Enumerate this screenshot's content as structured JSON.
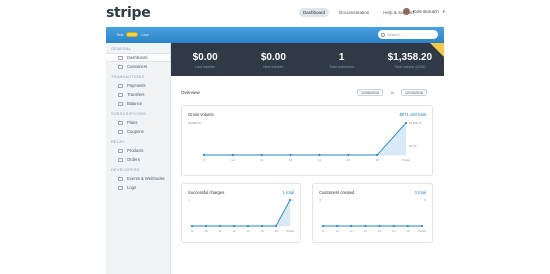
{
  "app": {
    "logo": "stripe"
  },
  "topnav": {
    "items": [
      "Dashboard",
      "Documentation",
      "Help & Support"
    ],
    "user_name": "Kole Borutch"
  },
  "mode": {
    "test_label": "Test",
    "live_label": "Live"
  },
  "search": {
    "placeholder": "Search..."
  },
  "sidebar": {
    "sections": [
      {
        "title": "GENERAL",
        "items": [
          "Dashboard",
          "Customers"
        ]
      },
      {
        "title": "TRANSACTIONS",
        "items": [
          "Payments",
          "Transfers",
          "Balance"
        ]
      },
      {
        "title": "SUBSCRIPTIONS",
        "items": [
          "Plans",
          "Coupons"
        ]
      },
      {
        "title": "RELAY",
        "items": [
          "Products",
          "Orders"
        ]
      },
      {
        "title": "DEVELOPERS",
        "items": [
          "Events & Webhooks",
          "Logs"
        ]
      }
    ]
  },
  "stats": [
    {
      "value": "$0.00",
      "label": "Last transfer"
    },
    {
      "value": "$0.00",
      "label": "Next transfer"
    },
    {
      "value": "1",
      "label": "Total customers"
    },
    {
      "value": "$1,358.20",
      "label": "Total volume (USD)"
    }
  ],
  "overview": {
    "title": "Overview",
    "from": "12/08/2015",
    "to_label": "to",
    "to": "12/15/2015"
  },
  "chart_data": [
    {
      "type": "area",
      "title": "Gross volume",
      "total": "$871,150 total",
      "categories": [
        "9",
        "10",
        "11",
        "12",
        "13",
        "14",
        "15",
        "Today"
      ],
      "values": [
        0,
        0,
        0,
        0,
        0,
        0,
        0,
        1358.2
      ],
      "y_left_label": "$1358.20",
      "y_right_label": "$1358.20",
      "y_bottom_label": "$0.00",
      "color": "#2a84c6"
    },
    {
      "type": "area",
      "title": "Successful charges",
      "total": "1 total",
      "categories": [
        "9",
        "10",
        "11",
        "12",
        "13",
        "14",
        "15",
        "Today"
      ],
      "values": [
        0,
        0,
        0,
        0,
        0,
        0,
        0,
        1
      ],
      "y_top_label": "1",
      "color": "#2a84c6"
    },
    {
      "type": "line",
      "title": "Customers created",
      "total": "0 total",
      "categories": [
        "9",
        "10",
        "11",
        "12",
        "13",
        "14",
        "15",
        "Today"
      ],
      "values": [
        0,
        0,
        0,
        0,
        0,
        0,
        0,
        0
      ],
      "y_top_label": "0",
      "color": "#2a84c6"
    }
  ]
}
